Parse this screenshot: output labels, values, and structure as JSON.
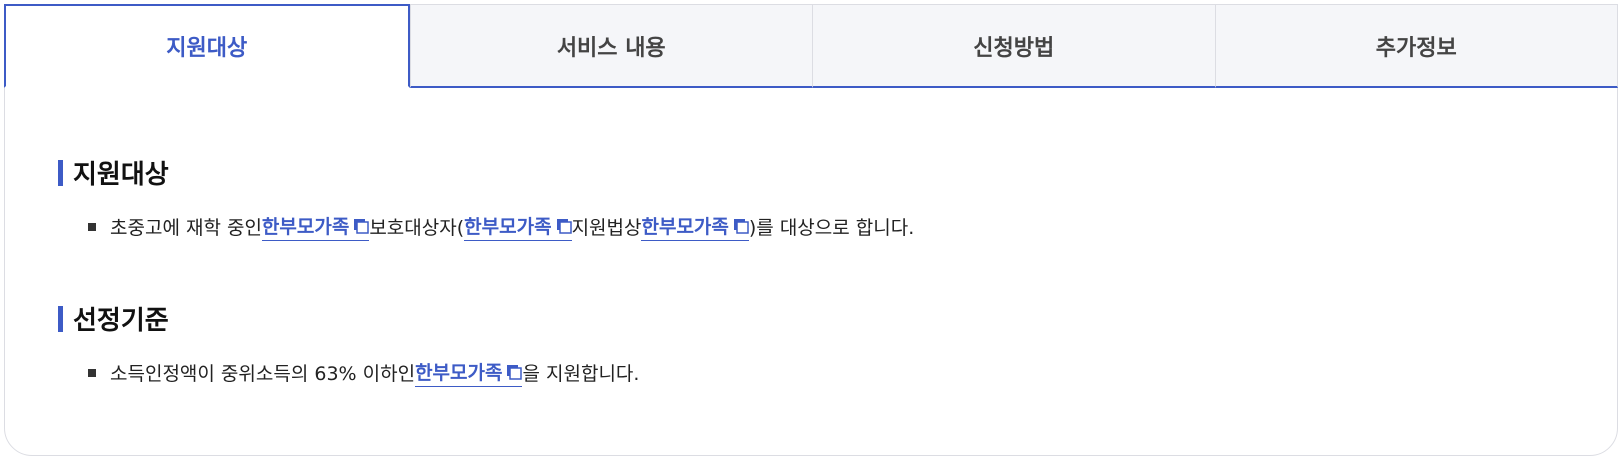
{
  "tabs": [
    {
      "label": "지원대상",
      "active": true
    },
    {
      "label": "서비스 내용",
      "active": false
    },
    {
      "label": "신청방법",
      "active": false
    },
    {
      "label": "추가정보",
      "active": false
    }
  ],
  "sections": {
    "target": {
      "title": "지원대상",
      "line": {
        "t1": "초중고에 재학 중인 ",
        "link1": "한부모가족",
        "t2": " 보호대상자(",
        "link2": "한부모가족",
        "t3": "지원법상 ",
        "link3": "한부모가족",
        "t4": ")를 대상으로 합니다."
      }
    },
    "criteria": {
      "title": "선정기준",
      "line": {
        "t1": "소득인정액이 중위소득의 63% 이하인 ",
        "link1": "한부모가족",
        "t2": "을 지원합니다."
      }
    }
  },
  "colors": {
    "accent": "#3d5bc6",
    "tab_bg": "#f5f6f9",
    "border": "#dcdde3"
  },
  "icons": {
    "link": "new-window-icon"
  }
}
